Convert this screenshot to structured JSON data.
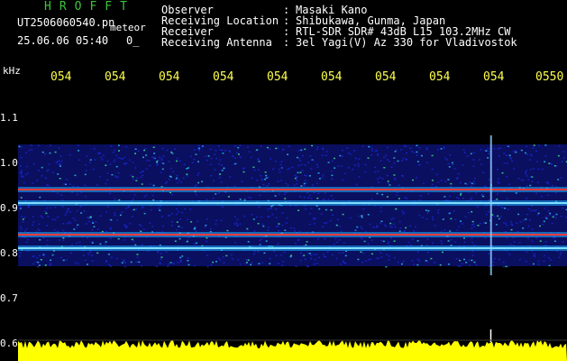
{
  "header": {
    "title": "HROFFT",
    "filename": "UT2506060540.pn",
    "filename_suffix": "meteor",
    "datetime": "25.06.06 05:40",
    "count": "0_"
  },
  "metadata": [
    {
      "label": "Observer",
      "value": "Masaki Kano"
    },
    {
      "label": "Receiving Location",
      "value": "Shibukawa, Gunma, Japan"
    },
    {
      "label": "Receiver",
      "value": "RTL-SDR SDR# 43dB L15 103.2MHz CW"
    },
    {
      "label": "Receiving Antenna",
      "value": "3el Yagi(V) Az 330 for Vladivostok"
    }
  ],
  "separator": ":",
  "axis": {
    "unit": "kHz",
    "time_ticks": [
      "054",
      "054",
      "054",
      "054",
      "054",
      "054",
      "054",
      "054",
      "054",
      "0550"
    ],
    "freq_ticks": [
      "1.1",
      "1.0",
      "0.9",
      "0.8",
      "0.7",
      "0.6"
    ]
  },
  "colors": {
    "title": "#3dc43d",
    "ticks": "#ffff4d",
    "background": "#000000",
    "noise": "#1a28d8",
    "signal": "#ff3b3b",
    "histogram": "#ffff00"
  },
  "chart_data": {
    "type": "heatmap",
    "x_ticks": [
      "054",
      "054",
      "054",
      "054",
      "054",
      "054",
      "054",
      "054",
      "054",
      "0550"
    ],
    "y_unit": "kHz",
    "y_ticks": [
      "1.1",
      "1.0",
      "0.9",
      "0.8",
      "0.7",
      "0.6"
    ],
    "y_range": [
      0.6,
      1.1
    ],
    "carrier_lines_khz": [
      0.94,
      0.91,
      0.84,
      0.81
    ],
    "noise_band_khz": [
      0.77,
      1.04
    ],
    "meteor_event_fraction": 0.86
  }
}
